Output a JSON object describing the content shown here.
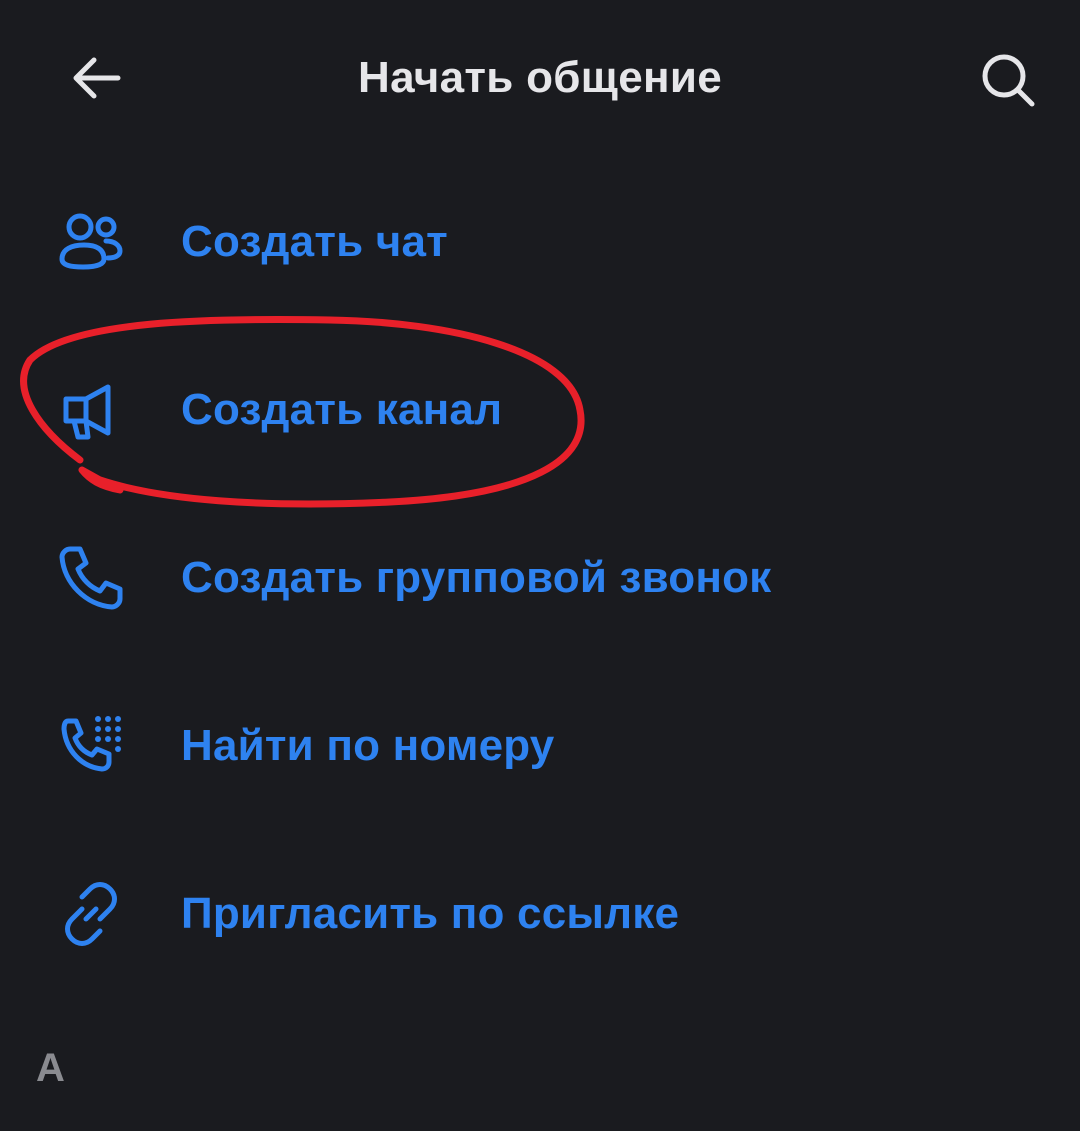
{
  "header": {
    "title": "Начать общение",
    "back_icon": "arrow-left-icon",
    "search_icon": "search-icon"
  },
  "menu": {
    "items": [
      {
        "label": "Создать чат",
        "icon": "users-icon"
      },
      {
        "label": "Создать канал",
        "icon": "megaphone-icon"
      },
      {
        "label": "Создать групповой звонок",
        "icon": "phone-icon"
      },
      {
        "label": "Найти по номеру",
        "icon": "phone-keypad-icon"
      },
      {
        "label": "Пригласить по ссылке",
        "icon": "link-icon"
      }
    ]
  },
  "section_letter": "А",
  "colors": {
    "background": "#1a1b1f",
    "accent": "#2e82f0",
    "title": "#e6e6e9",
    "annotation": "#e8202a",
    "muted": "#8a8b90"
  }
}
